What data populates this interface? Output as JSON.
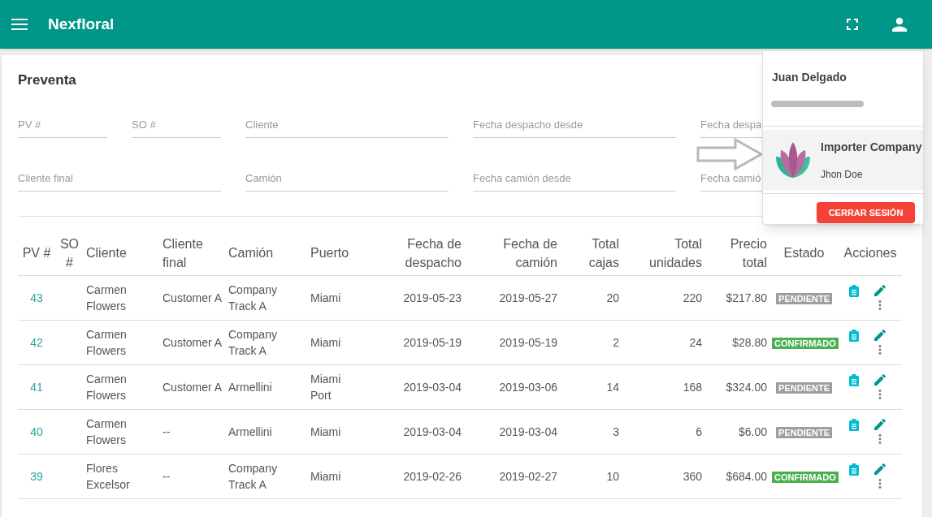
{
  "app_bar": {
    "title": "Nexfloral"
  },
  "page": {
    "title": "Preventa"
  },
  "filters": [
    {
      "placeholder": "PV #"
    },
    {
      "placeholder": "SO #"
    },
    {
      "placeholder": "Cliente"
    },
    {
      "placeholder": "Fecha despacho desde"
    },
    {
      "placeholder": "Fecha despa"
    },
    {
      "placeholder": "Cliente final"
    },
    {
      "placeholder": "Camión"
    },
    {
      "placeholder": "Fecha camión desde"
    },
    {
      "placeholder": "Fecha camió"
    }
  ],
  "table": {
    "columns": [
      {
        "label": "PV #"
      },
      {
        "label": "SO #"
      },
      {
        "label": "Cliente"
      },
      {
        "label": "Cliente final"
      },
      {
        "label": "Camión"
      },
      {
        "label": "Puerto"
      },
      {
        "label": "Fecha de despacho"
      },
      {
        "label": "Fecha de camión"
      },
      {
        "label": "Total cajas"
      },
      {
        "label": "Total unidades"
      },
      {
        "label": "Precio total"
      },
      {
        "label": "Estado"
      },
      {
        "label": "Acciones"
      }
    ],
    "rows": [
      {
        "pv": "43",
        "cliente": "Carmen Flowers",
        "cliente_final": "Customer A",
        "camion": "Company Track A",
        "puerto": "Miami",
        "fecha_despacho": "2019-05-23",
        "fecha_camion": "2019-05-27",
        "total_cajas": "20",
        "total_unidades": "220",
        "precio_total": "$217.80",
        "estado": {
          "label": "PENDIENTE",
          "kind": "pending"
        }
      },
      {
        "pv": "42",
        "cliente": "Carmen Flowers",
        "cliente_final": "Customer A",
        "camion": "Company Track A",
        "puerto": "Miami",
        "fecha_despacho": "2019-05-19",
        "fecha_camion": "2019-05-19",
        "total_cajas": "2",
        "total_unidades": "24",
        "precio_total": "$28.80",
        "estado": {
          "label": "CONFIRMADO",
          "kind": "confirmed"
        }
      },
      {
        "pv": "41",
        "cliente": "Carmen Flowers",
        "cliente_final": "Customer A",
        "camion": "Armellini",
        "puerto": "Miami Port",
        "fecha_despacho": "2019-03-04",
        "fecha_camion": "2019-03-06",
        "total_cajas": "14",
        "total_unidades": "168",
        "precio_total": "$324.00",
        "estado": {
          "label": "PENDIENTE",
          "kind": "pending"
        }
      },
      {
        "pv": "40",
        "cliente": "Carmen Flowers",
        "cliente_final": "--",
        "camion": "Armellini",
        "puerto": "Miami",
        "fecha_despacho": "2019-03-04",
        "fecha_camion": "2019-03-04",
        "total_cajas": "3",
        "total_unidades": "6",
        "precio_total": "$6.00",
        "estado": {
          "label": "PENDIENTE",
          "kind": "pending"
        }
      },
      {
        "pv": "39",
        "cliente": "Flores Excelsor",
        "cliente_final": "--",
        "camion": "Company Track A",
        "puerto": "Miami",
        "fecha_despacho": "2019-02-26",
        "fecha_camion": "2019-02-27",
        "total_cajas": "10",
        "total_unidades": "360",
        "precio_total": "$684.00",
        "estado": {
          "label": "CONFIRMADO",
          "kind": "confirmed"
        }
      }
    ]
  },
  "user_menu": {
    "name": "Juan Delgado",
    "company": "Importer Company",
    "contact": "Jhon Doe",
    "logout_button": "CERRAR SESIÓN"
  }
}
